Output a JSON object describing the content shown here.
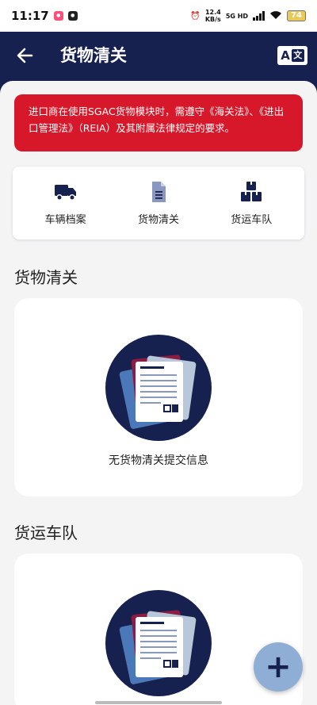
{
  "status_bar": {
    "time": "11:17",
    "net_speed": "12.4",
    "net_unit": "KB/s",
    "network": "5G HD",
    "battery": "74"
  },
  "header": {
    "title": "货物清关",
    "lang_icon_left": "A",
    "lang_icon_right": "文"
  },
  "notice": {
    "text": "进口商在使用SGAC货物模块时，需遵守《海关法》、《进出口管理法》（REIA）及其附属法律规定的要求。"
  },
  "quick_actions": [
    {
      "label": "车辆档案",
      "icon": "truck-icon"
    },
    {
      "label": "货物清关",
      "icon": "document-icon"
    },
    {
      "label": "货运车队",
      "icon": "boxes-icon"
    }
  ],
  "sections": {
    "cargo": {
      "title": "货物清关",
      "empty_text": "无货物清关提交信息"
    },
    "fleet": {
      "title": "货运车队"
    }
  },
  "fab": {
    "label": "+"
  },
  "colors": {
    "header_bg": "#17214f",
    "notice_bg": "#d7182a",
    "fab_bg": "#8eaed6",
    "illus_circle": "#17214f"
  }
}
